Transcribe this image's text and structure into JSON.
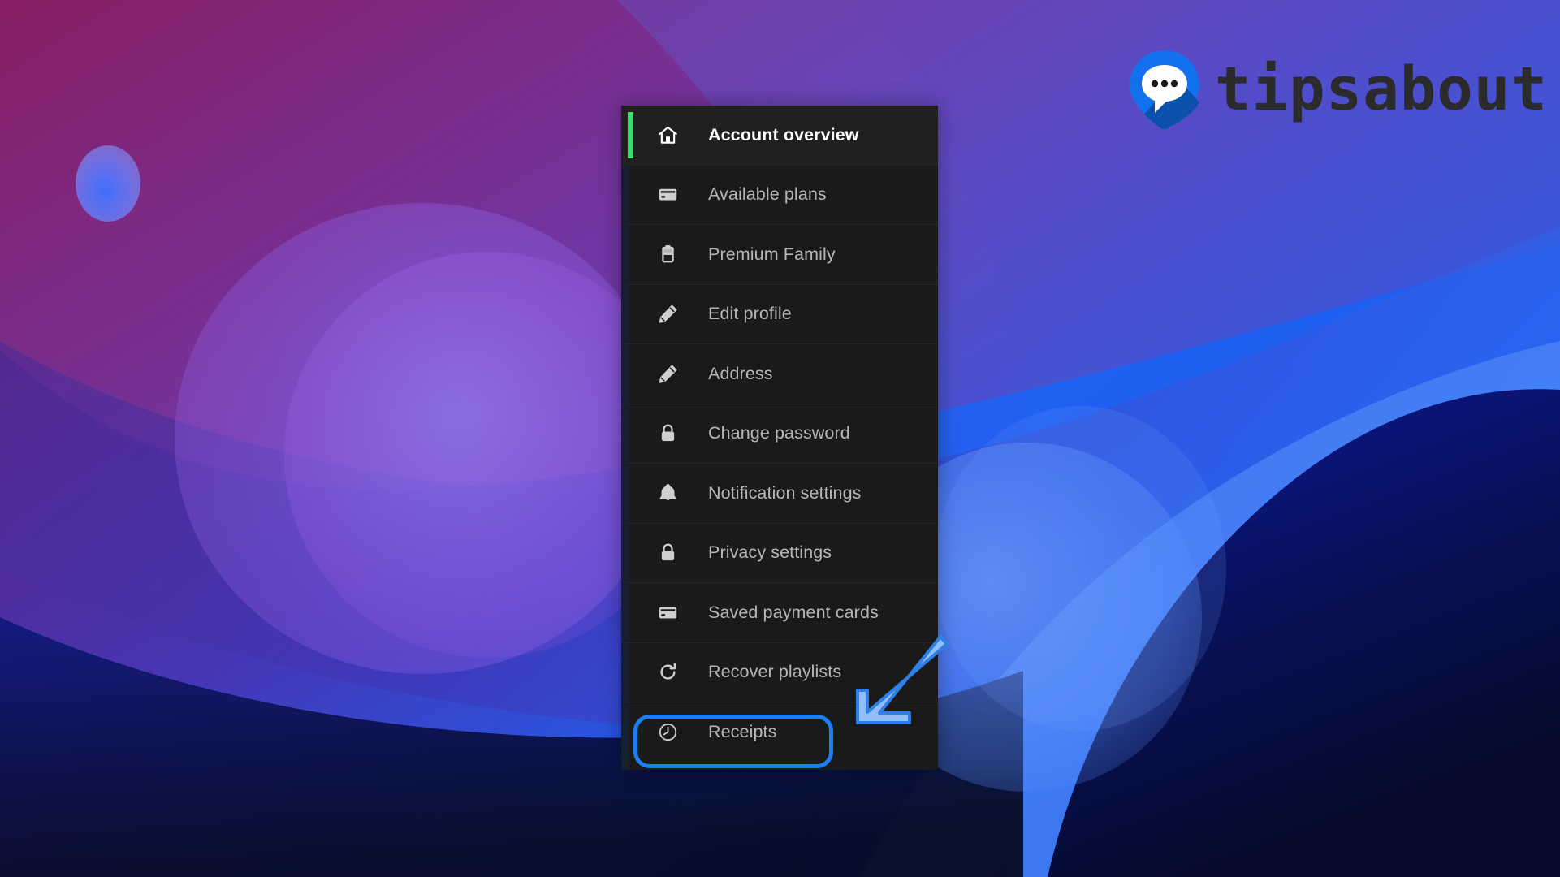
{
  "brand": {
    "wordmark": "tipsabout",
    "logo_icon": "speech-bubble-pin-icon",
    "logo_color": "#1271EE",
    "logo_shadow_color": "#0B4FA8",
    "wordmark_color": "#2b2b2b"
  },
  "menu": {
    "panel_background": "#1a1a1a",
    "active_indicator_color": "#3cdc6e",
    "items": [
      {
        "label": "Account overview",
        "icon": "home-icon",
        "active": true
      },
      {
        "label": "Available plans",
        "icon": "credit-card-icon",
        "active": false
      },
      {
        "label": "Premium Family",
        "icon": "clipboard-icon",
        "active": false
      },
      {
        "label": "Edit profile",
        "icon": "pencil-icon",
        "active": false
      },
      {
        "label": "Address",
        "icon": "pencil-icon",
        "active": false
      },
      {
        "label": "Change password",
        "icon": "lock-icon",
        "active": false
      },
      {
        "label": "Notification settings",
        "icon": "bell-icon",
        "active": false
      },
      {
        "label": "Privacy settings",
        "icon": "lock-icon",
        "active": false
      },
      {
        "label": "Saved payment cards",
        "icon": "credit-card-icon",
        "active": false
      },
      {
        "label": "Recover playlists",
        "icon": "refresh-icon",
        "active": false
      },
      {
        "label": "Receipts",
        "icon": "clock-history-icon",
        "active": false
      }
    ]
  },
  "annotations": {
    "highlight": {
      "target_label": "Receipts",
      "shape": "rounded-rectangle",
      "color": "#1a7ff0"
    },
    "arrow": {
      "points_to": "Receipts",
      "direction": "down-left",
      "fill_color": "#93bdf7",
      "stroke_color": "#2f7fe8"
    }
  },
  "background": {
    "style": "abstract-gradient-blobs",
    "colors": {
      "top_left_magenta": "#7a1352",
      "purple": "#5b2a96",
      "indigo": "#4a3fb5",
      "blue": "#1f63f0",
      "bright_blue": "#4b8ef8",
      "deep_navy": "#0a0a3a",
      "near_black_navy": "#060a22"
    }
  }
}
